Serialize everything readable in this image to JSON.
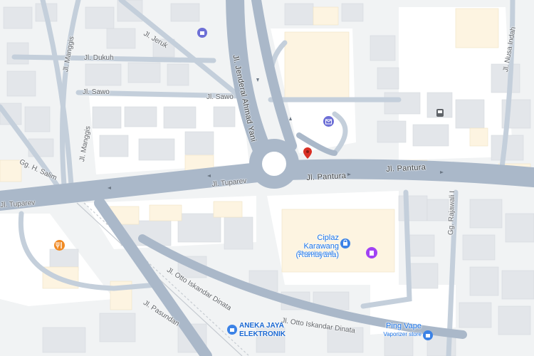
{
  "colors": {
    "background": "#f1f3f4",
    "block": "#ffffff",
    "building": "#e8eaed",
    "building_warm": "#fdf4e1",
    "road": "#aab8c9",
    "road_light": "#c4cfdb",
    "rail": "#bdc1c6",
    "poi_blue": "#3b82e6",
    "poi_orange": "#f08a24",
    "poi_purple": "#a142f4",
    "pin_red": "#d93025"
  },
  "streets": {
    "ahmad_yani": "Jl. Jenderal Ahmad Yani",
    "pantura_1": "Jl. Pantura",
    "pantura_2": "Jl. Pantura",
    "tuparev_1": "Jl. Tuparev",
    "tuparev_2": "Jl. Tuparev",
    "otto_1": "Jl. Otto Iskandar Dinata",
    "otto_2": "Jl. Otto Iskandar Dinata",
    "pasundan": "Jl. Pasundan",
    "manggis_1": "Jl. Manggis",
    "manggis_2": "Jl. Manggis",
    "dukuh": "Jl. Dukuh",
    "sawo_1": "Jl. Sawo",
    "sawo_2": "Jl. Sawo",
    "jeruk": "Jl. Jeruk",
    "nusa_indah": "Jl. Nusa Indah",
    "salim": "Gg. H. Salim",
    "rajawali": "Gg. Rajawali I"
  },
  "places": {
    "ciplaz_name": "Ciplaz Karawang\n(Ramayana)",
    "ciplaz_sub": "Shopping mall",
    "aneka_name": "ANEKA JAYA\nELEKTRONIK",
    "ping_name": "Ping Vape",
    "ping_sub": "Vaporizer store"
  },
  "icons": {
    "mall": "shopping-bag-icon",
    "restaurant": "fork-knife-icon",
    "post": "mail-icon",
    "bus": "bus-icon",
    "shop": "shopping-bag-icon",
    "pin": "map-pin-icon"
  }
}
